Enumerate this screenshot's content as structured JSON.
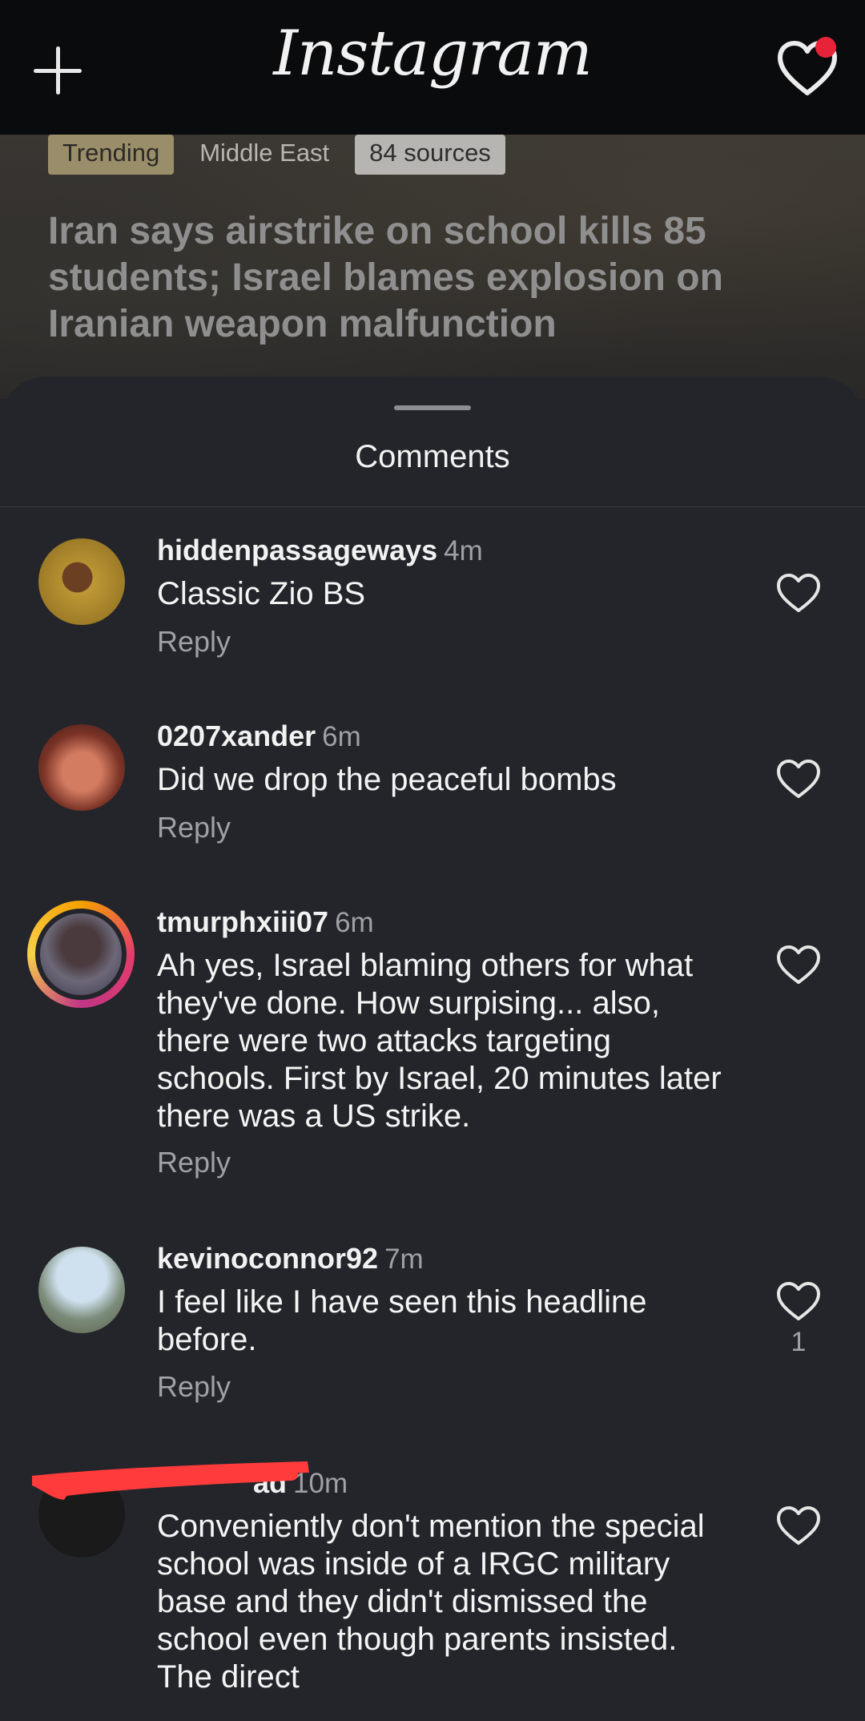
{
  "app": {
    "title": "Instagram"
  },
  "article": {
    "tags": [
      "Trending",
      "Middle East",
      "84 sources"
    ],
    "headline": "Iran says airstrike on school kills 85 students; Israel blames explosion on Iranian weapon malfunction"
  },
  "sheet": {
    "title": "Comments"
  },
  "icons": {
    "new_post": "plus-icon",
    "activity": "heart-icon",
    "like": "heart-outline-icon"
  },
  "colors": {
    "background": "#23252a",
    "notification": "#e7233a",
    "redaction": "#ff3b3b"
  },
  "comments": [
    {
      "username": "hiddenpassageways",
      "time": "4m",
      "text": "Classic Zio BS",
      "reply": "Reply",
      "likes": ""
    },
    {
      "username": "0207xander",
      "time": "6m",
      "text": "Did we drop the peaceful bombs",
      "reply": "Reply",
      "likes": ""
    },
    {
      "username": "tmurphxiii07",
      "time": "6m",
      "text": "Ah yes, Israel blaming others for what they've done. How surpising... also, there were two attacks targeting schools. First by Israel, 20 minutes later there was a US strike.",
      "reply": "Reply",
      "likes": ""
    },
    {
      "username": "kevinoconnor92",
      "time": "7m",
      "text": "I feel like I have seen this headline before.",
      "reply": "Reply",
      "likes": "1"
    },
    {
      "username": "ad",
      "time": "10m",
      "text": "Conveniently don't mention the special school was inside of a IRGC military base and they didn't dismissed the school even though parents insisted. The direct",
      "reply": "",
      "likes": ""
    }
  ]
}
